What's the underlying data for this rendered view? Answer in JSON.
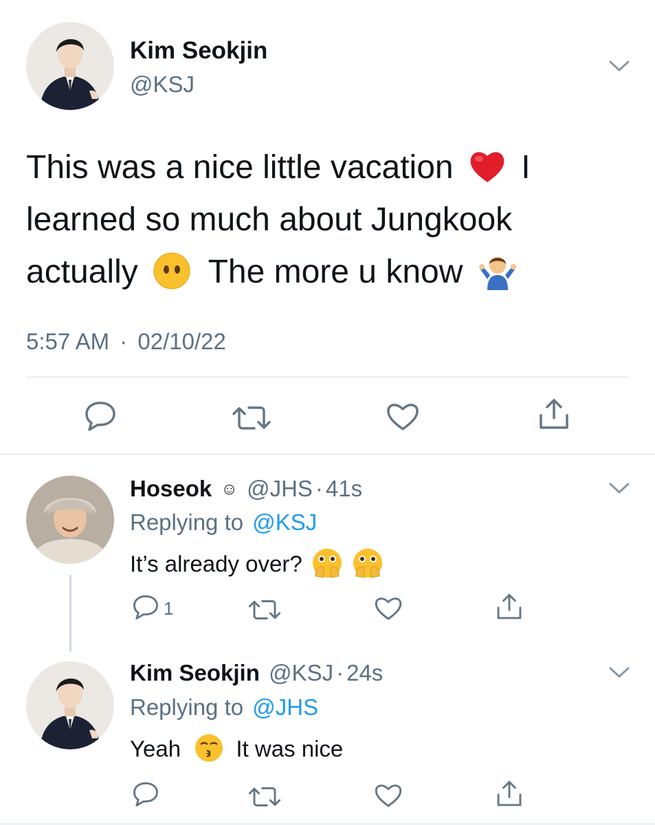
{
  "main_tweet": {
    "author_name": "Kim Seokjin",
    "author_handle": "@KSJ",
    "text_line1": "This was a nice little vacation",
    "text_line1_end": "I",
    "text_line2": "learned so much about Jungkook",
    "text_line3a": "actually",
    "text_line3b": "The more u know",
    "emojis": [
      "red-heart-emoji",
      "face-without-mouth-emoji",
      "man-shrugging-emoji"
    ],
    "time": "5:57 AM",
    "separator": "·",
    "date": "02/10/22"
  },
  "replies": [
    {
      "author_name": "Hoseok",
      "author_badge": "☺",
      "author_handle": "@JHS",
      "separator": "·",
      "age": "41s",
      "replying_prefix": "Replying to",
      "replying_handle": "@KSJ",
      "text": "It’s already over?",
      "emojis": [
        "face-with-open-eyes-and-hand-over-mouth-emoji",
        "face-with-open-eyes-and-hand-over-mouth-emoji"
      ],
      "reply_count": "1"
    },
    {
      "author_name": "Kim Seokjin",
      "author_handle": "@KSJ",
      "separator": "·",
      "age": "24s",
      "replying_prefix": "Replying to",
      "replying_handle": "@JHS",
      "text_a": "Yeah",
      "text_b": "It was nice",
      "emojis": [
        "kissing-face-emoji"
      ]
    }
  ],
  "colors": {
    "text": "#0f1419",
    "secondary": "#5b7083",
    "link": "#1d9bf0",
    "divider": "#d7dde2"
  }
}
